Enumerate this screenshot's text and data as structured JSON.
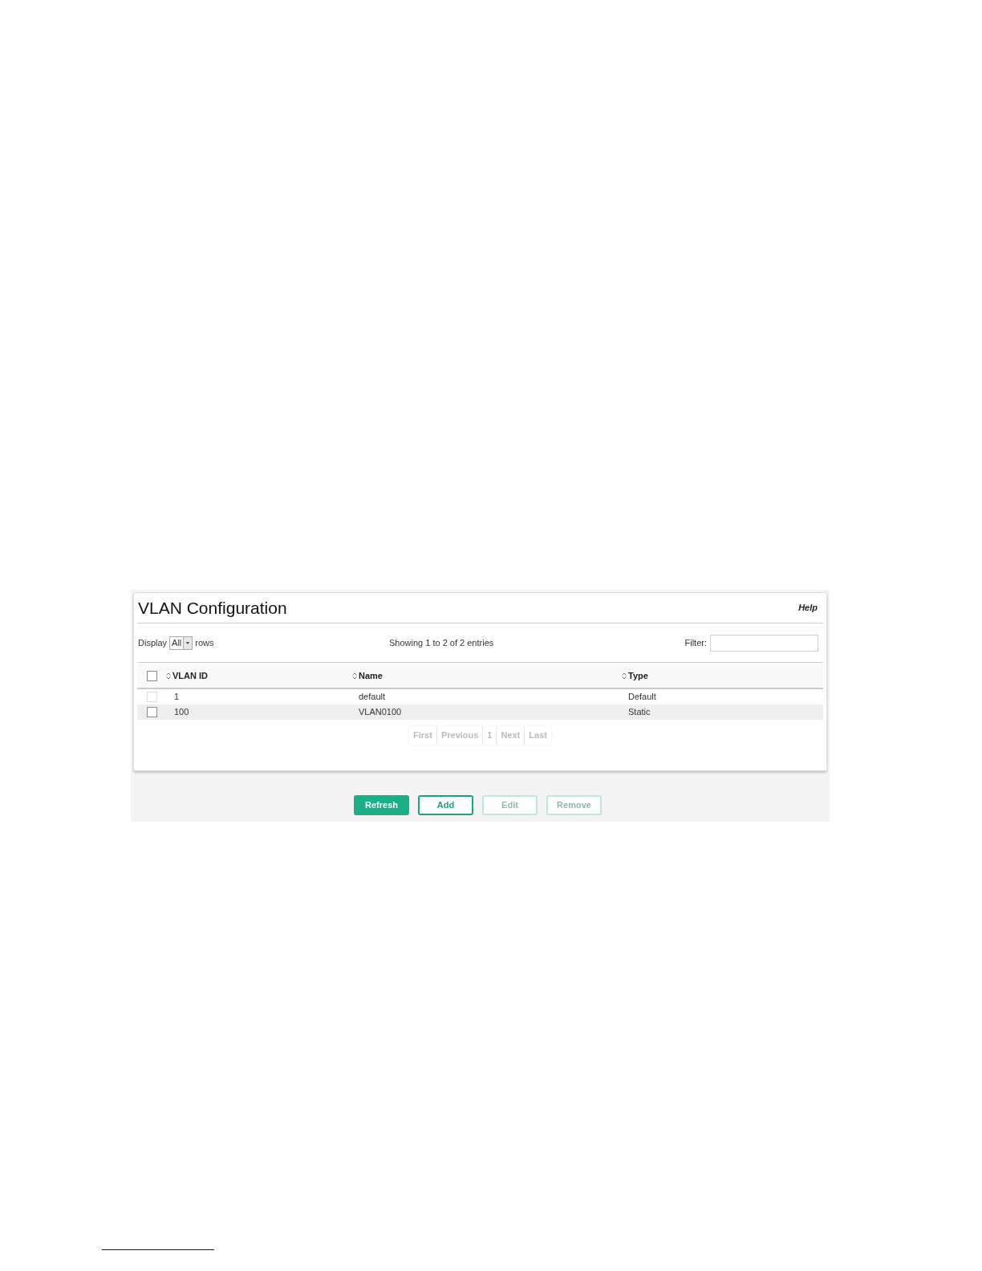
{
  "panel": {
    "title": "VLAN Configuration",
    "help": "Help"
  },
  "toolbar": {
    "display_label": "Display",
    "display_value": "All",
    "rows_label": "rows",
    "summary": "Showing 1 to 2 of 2 entries",
    "filter_label": "Filter:"
  },
  "table": {
    "select_all_checked": false,
    "columns": [
      "VLAN ID",
      "Name",
      "Type"
    ],
    "rows": [
      {
        "checked": false,
        "disabled": true,
        "cells": [
          "1",
          "default",
          "Default"
        ]
      },
      {
        "checked": false,
        "disabled": false,
        "cells": [
          "100",
          "VLAN0100",
          "Static"
        ]
      }
    ]
  },
  "pagination": [
    {
      "label": "First",
      "disabled": true
    },
    {
      "label": "Previous",
      "disabled": true
    },
    {
      "label": "1",
      "disabled": true
    },
    {
      "label": "Next",
      "disabled": true
    },
    {
      "label": "Last",
      "disabled": true
    }
  ],
  "buttons": [
    {
      "label": "Refresh",
      "kind": "primary",
      "disabled": false
    },
    {
      "label": "Add",
      "kind": "outline",
      "disabled": false
    },
    {
      "label": "Edit",
      "kind": "outline",
      "disabled": true
    },
    {
      "label": "Remove",
      "kind": "outline",
      "disabled": true
    }
  ]
}
